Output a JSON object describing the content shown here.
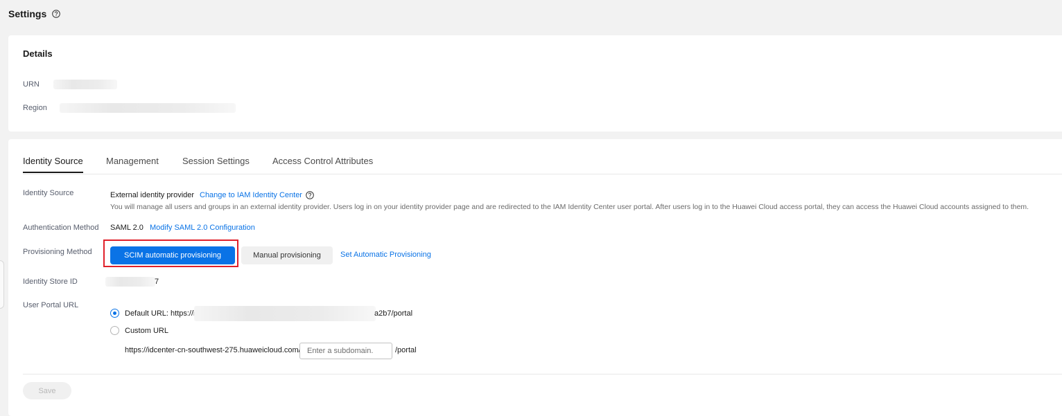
{
  "header": {
    "title": "Settings"
  },
  "details": {
    "title": "Details",
    "urn_label": "URN",
    "region_label": "Region"
  },
  "tabs": [
    {
      "label": "Identity Source",
      "active": true
    },
    {
      "label": "Management",
      "active": false
    },
    {
      "label": "Session Settings",
      "active": false
    },
    {
      "label": "Access Control Attributes",
      "active": false
    }
  ],
  "identity_source": {
    "label": "Identity Source",
    "value": "External identity provider",
    "change_link": "Change to IAM Identity Center",
    "description": "You will manage all users and groups in an external identity provider. Users log in on your identity provider page and are redirected to the IAM Identity Center user portal. After users log in to the Huawei Cloud access portal, they can access the Huawei Cloud accounts assigned to them."
  },
  "authentication": {
    "label": "Authentication Method",
    "value": "SAML 2.0",
    "modify_link": "Modify SAML 2.0 Configuration"
  },
  "provisioning": {
    "label": "Provisioning Method",
    "scim_button": "SCIM automatic provisioning",
    "manual_button": "Manual provisioning",
    "set_link": "Set Automatic Provisioning"
  },
  "identity_store": {
    "label": "Identity Store ID",
    "visible_suffix": "7"
  },
  "user_portal": {
    "label": "User Portal URL",
    "default_option": "Default URL: https://i",
    "default_suffix": "a2b7/portal",
    "custom_option": "Custom URL",
    "custom_prefix": "https://idcenter-cn-southwest-275.huaweicloud.com/",
    "subdomain_placeholder": "Enter a subdomain.",
    "custom_suffix": "/portal",
    "selected": "default"
  },
  "footer": {
    "save_label": "Save"
  },
  "colors": {
    "primary": "#0a73e6",
    "highlight": "#e0202a"
  }
}
